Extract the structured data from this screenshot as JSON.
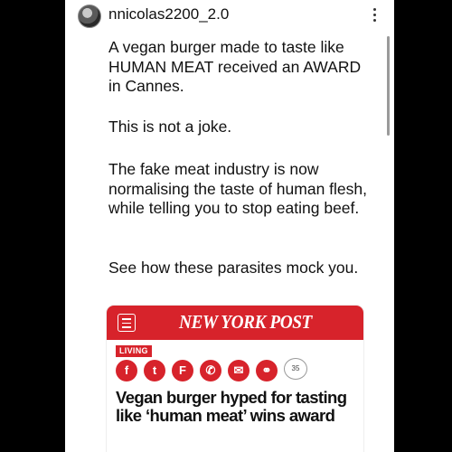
{
  "post": {
    "username": "nnicolas2200_2.0",
    "paragraphs": [
      "A vegan burger made to taste like HUMAN MEAT received an AWARD in Cannes.",
      "This is not a joke.",
      "The fake meat industry is now normalising the taste of human flesh, while telling you to stop eating beef.",
      "See how these parasites mock you."
    ]
  },
  "article": {
    "publisher": "NEW YORK POST",
    "section": "LIVING",
    "share_icons": [
      "facebook-icon",
      "twitter-icon",
      "flipboard-icon",
      "whatsapp-icon",
      "email-icon",
      "link-icon"
    ],
    "share_glyphs": [
      "f",
      "t",
      "F",
      "✆",
      "✉",
      "⚭"
    ],
    "comment_count": "35",
    "headline": "Vegan burger hyped for tasting like ‘human meat’ wins award"
  },
  "colors": {
    "brand_red": "#d7232b",
    "text": "#111111"
  }
}
